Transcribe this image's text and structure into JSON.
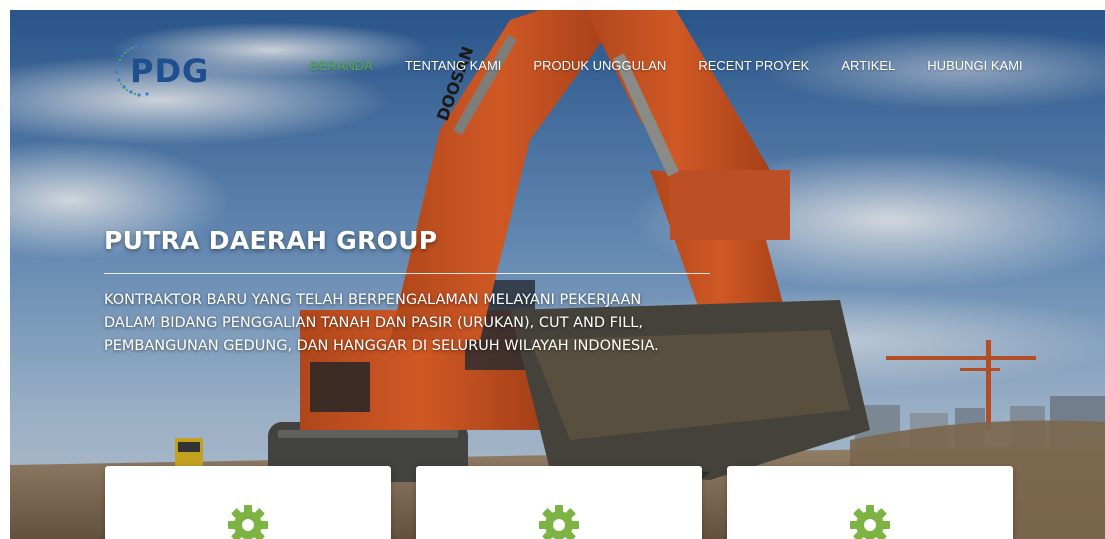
{
  "brand": {
    "logo_text": "PDG"
  },
  "nav": {
    "items": [
      {
        "label": "BERANDA",
        "active": true
      },
      {
        "label": "TENTANG KAMI",
        "active": false
      },
      {
        "label": "PRODUK UNGGULAN",
        "active": false
      },
      {
        "label": "RECENT PROYEK",
        "active": false
      },
      {
        "label": "ARTIKEL",
        "active": false
      },
      {
        "label": "HUBUNGI KAMI",
        "active": false
      }
    ],
    "active_color": "#4caf50"
  },
  "hero": {
    "title": "PUTRA DAERAH GROUP",
    "description_lines": [
      "KONTRAKTOR BARU YANG TELAH BERPENGALAMAN MELAYANI PEKERJAAN",
      "DALAM BIDANG PENGGALIAN TANAH DAN PASIR (URUKAN), CUT AND FILL,",
      "PEMBANGUNAN GEDUNG, DAN HANGGAR DI SELURUH WILAYAH INDONESIA."
    ],
    "background_image": "excavator-on-construction-site"
  },
  "cards": [
    {
      "icon": "gear-icon"
    },
    {
      "icon": "gear-icon"
    },
    {
      "icon": "gear-icon"
    }
  ],
  "colors": {
    "brand_blue": "#1f4f8f",
    "accent_green": "#7cb342",
    "excavator_orange": "#e8632a"
  }
}
